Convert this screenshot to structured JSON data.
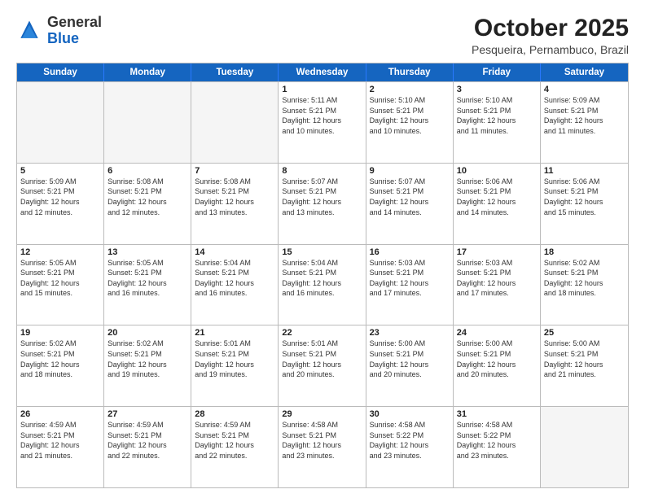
{
  "logo": {
    "general": "General",
    "blue": "Blue"
  },
  "header": {
    "month": "October 2025",
    "location": "Pesqueira, Pernambuco, Brazil"
  },
  "weekdays": [
    "Sunday",
    "Monday",
    "Tuesday",
    "Wednesday",
    "Thursday",
    "Friday",
    "Saturday"
  ],
  "weeks": [
    [
      {
        "day": "",
        "info": ""
      },
      {
        "day": "",
        "info": ""
      },
      {
        "day": "",
        "info": ""
      },
      {
        "day": "1",
        "info": "Sunrise: 5:11 AM\nSunset: 5:21 PM\nDaylight: 12 hours\nand 10 minutes."
      },
      {
        "day": "2",
        "info": "Sunrise: 5:10 AM\nSunset: 5:21 PM\nDaylight: 12 hours\nand 10 minutes."
      },
      {
        "day": "3",
        "info": "Sunrise: 5:10 AM\nSunset: 5:21 PM\nDaylight: 12 hours\nand 11 minutes."
      },
      {
        "day": "4",
        "info": "Sunrise: 5:09 AM\nSunset: 5:21 PM\nDaylight: 12 hours\nand 11 minutes."
      }
    ],
    [
      {
        "day": "5",
        "info": "Sunrise: 5:09 AM\nSunset: 5:21 PM\nDaylight: 12 hours\nand 12 minutes."
      },
      {
        "day": "6",
        "info": "Sunrise: 5:08 AM\nSunset: 5:21 PM\nDaylight: 12 hours\nand 12 minutes."
      },
      {
        "day": "7",
        "info": "Sunrise: 5:08 AM\nSunset: 5:21 PM\nDaylight: 12 hours\nand 13 minutes."
      },
      {
        "day": "8",
        "info": "Sunrise: 5:07 AM\nSunset: 5:21 PM\nDaylight: 12 hours\nand 13 minutes."
      },
      {
        "day": "9",
        "info": "Sunrise: 5:07 AM\nSunset: 5:21 PM\nDaylight: 12 hours\nand 14 minutes."
      },
      {
        "day": "10",
        "info": "Sunrise: 5:06 AM\nSunset: 5:21 PM\nDaylight: 12 hours\nand 14 minutes."
      },
      {
        "day": "11",
        "info": "Sunrise: 5:06 AM\nSunset: 5:21 PM\nDaylight: 12 hours\nand 15 minutes."
      }
    ],
    [
      {
        "day": "12",
        "info": "Sunrise: 5:05 AM\nSunset: 5:21 PM\nDaylight: 12 hours\nand 15 minutes."
      },
      {
        "day": "13",
        "info": "Sunrise: 5:05 AM\nSunset: 5:21 PM\nDaylight: 12 hours\nand 16 minutes."
      },
      {
        "day": "14",
        "info": "Sunrise: 5:04 AM\nSunset: 5:21 PM\nDaylight: 12 hours\nand 16 minutes."
      },
      {
        "day": "15",
        "info": "Sunrise: 5:04 AM\nSunset: 5:21 PM\nDaylight: 12 hours\nand 16 minutes."
      },
      {
        "day": "16",
        "info": "Sunrise: 5:03 AM\nSunset: 5:21 PM\nDaylight: 12 hours\nand 17 minutes."
      },
      {
        "day": "17",
        "info": "Sunrise: 5:03 AM\nSunset: 5:21 PM\nDaylight: 12 hours\nand 17 minutes."
      },
      {
        "day": "18",
        "info": "Sunrise: 5:02 AM\nSunset: 5:21 PM\nDaylight: 12 hours\nand 18 minutes."
      }
    ],
    [
      {
        "day": "19",
        "info": "Sunrise: 5:02 AM\nSunset: 5:21 PM\nDaylight: 12 hours\nand 18 minutes."
      },
      {
        "day": "20",
        "info": "Sunrise: 5:02 AM\nSunset: 5:21 PM\nDaylight: 12 hours\nand 19 minutes."
      },
      {
        "day": "21",
        "info": "Sunrise: 5:01 AM\nSunset: 5:21 PM\nDaylight: 12 hours\nand 19 minutes."
      },
      {
        "day": "22",
        "info": "Sunrise: 5:01 AM\nSunset: 5:21 PM\nDaylight: 12 hours\nand 20 minutes."
      },
      {
        "day": "23",
        "info": "Sunrise: 5:00 AM\nSunset: 5:21 PM\nDaylight: 12 hours\nand 20 minutes."
      },
      {
        "day": "24",
        "info": "Sunrise: 5:00 AM\nSunset: 5:21 PM\nDaylight: 12 hours\nand 20 minutes."
      },
      {
        "day": "25",
        "info": "Sunrise: 5:00 AM\nSunset: 5:21 PM\nDaylight: 12 hours\nand 21 minutes."
      }
    ],
    [
      {
        "day": "26",
        "info": "Sunrise: 4:59 AM\nSunset: 5:21 PM\nDaylight: 12 hours\nand 21 minutes."
      },
      {
        "day": "27",
        "info": "Sunrise: 4:59 AM\nSunset: 5:21 PM\nDaylight: 12 hours\nand 22 minutes."
      },
      {
        "day": "28",
        "info": "Sunrise: 4:59 AM\nSunset: 5:21 PM\nDaylight: 12 hours\nand 22 minutes."
      },
      {
        "day": "29",
        "info": "Sunrise: 4:58 AM\nSunset: 5:21 PM\nDaylight: 12 hours\nand 23 minutes."
      },
      {
        "day": "30",
        "info": "Sunrise: 4:58 AM\nSunset: 5:22 PM\nDaylight: 12 hours\nand 23 minutes."
      },
      {
        "day": "31",
        "info": "Sunrise: 4:58 AM\nSunset: 5:22 PM\nDaylight: 12 hours\nand 23 minutes."
      },
      {
        "day": "",
        "info": ""
      }
    ]
  ]
}
